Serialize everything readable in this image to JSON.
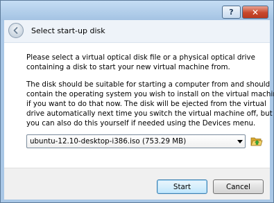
{
  "window": {
    "help_symbol": "?",
    "close_symbol": "✕"
  },
  "header": {
    "title": "Select start-up disk"
  },
  "content": {
    "intro_lines": [
      "Please select a virtual optical disk file or a physical optical drive",
      "containing a disk to start your new virtual machine from."
    ],
    "detail_lines": [
      "The disk should be suitable for starting a computer from and should",
      "contain the operating system you wish to install on the virtual machine",
      "if you want to do that now. The disk will be ejected from the virtual",
      "drive automatically next time you switch the virtual machine off, but",
      "you can also do this yourself if needed using the Devices menu."
    ],
    "disk_select": {
      "value": "ubuntu-12.10-desktop-i386.iso (753.29 MB)"
    }
  },
  "footer": {
    "start_label": "Start",
    "cancel_label": "Cancel"
  },
  "colors": {
    "frame": "#a9c7e6",
    "close_button": "#c7472c",
    "default_button_border": "#3c7fb1",
    "folder": "#e8c04a",
    "folder_arrow": "#3aa83a"
  },
  "icons": {
    "back": "back-arrow-icon",
    "dropdown": "chevron-down-icon",
    "folder": "folder-open-icon"
  }
}
